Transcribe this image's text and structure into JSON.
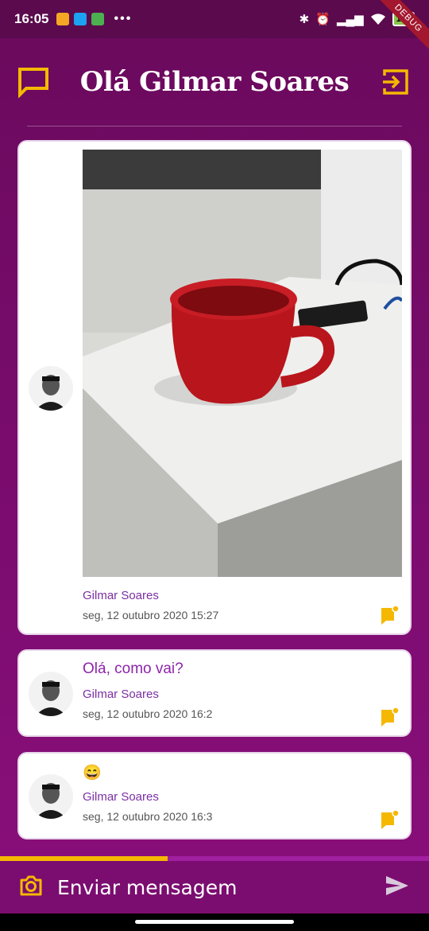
{
  "status_bar": {
    "time": "16:05",
    "dots": "•••",
    "battery": "100",
    "debug_label": "DEBUG"
  },
  "header": {
    "title": "Olá Gilmar Soares",
    "left_icon": "chat-bubble-icon",
    "right_icon": "logout-icon"
  },
  "colors": {
    "accent": "#f5b800",
    "purple_text": "#8e24aa",
    "background": "#7a0c6e"
  },
  "messages": [
    {
      "type": "image",
      "author": "Gilmar Soares",
      "date": "seg, 12 outubro 2020 15:27"
    },
    {
      "type": "text",
      "text": "Olá, como vai?",
      "author": "Gilmar Soares",
      "date": "seg, 12 outubro 2020 16:2"
    },
    {
      "type": "text",
      "text": "😄",
      "author": "Gilmar Soares",
      "date": "seg, 12 outubro 2020 16:3"
    }
  ],
  "upload_progress": 0.39,
  "composer": {
    "placeholder": "Enviar mensagem",
    "camera_icon": "camera-icon",
    "send_icon": "send-icon"
  }
}
